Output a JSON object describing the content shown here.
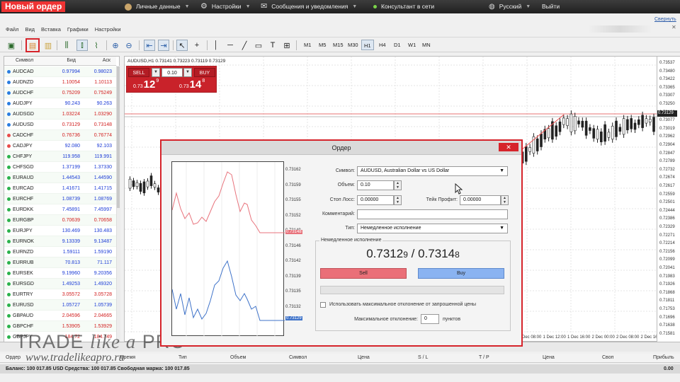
{
  "top": {
    "title": "Новый ордер",
    "personal": "Личные данные",
    "settings": "Настройки",
    "messages": "Сообщения и уведомления",
    "consultant": "Консультант в сети",
    "language": "Русский",
    "logout": "Выйти",
    "chart_link": "Свернуть"
  },
  "menu": [
    "Файл",
    "Вид",
    "Вставка",
    "Графики",
    "Настройки"
  ],
  "timeframes": [
    "M1",
    "M5",
    "M15",
    "M30",
    "H1",
    "H4",
    "D1",
    "W1",
    "MN"
  ],
  "active_timeframe": "H1",
  "market_watch": {
    "headers": {
      "symbol": "Символ",
      "bid": "Бид",
      "ask": "Аск"
    },
    "rows": [
      {
        "s": "AUDCAD",
        "b": "0.97994",
        "a": "0.98023",
        "dir": "up",
        "c": "#2a7de1"
      },
      {
        "s": "AUDNZD",
        "b": "1.10054",
        "a": "1.10113",
        "dir": "down",
        "c": "#2a7de1"
      },
      {
        "s": "AUDCHF",
        "b": "0.75209",
        "a": "0.75249",
        "dir": "down",
        "c": "#2a7de1"
      },
      {
        "s": "AUDJPY",
        "b": "90.243",
        "a": "90.263",
        "dir": "up",
        "c": "#2a7de1"
      },
      {
        "s": "AUDSGD",
        "b": "1.03224",
        "a": "1.03290",
        "dir": "down",
        "c": "#2a7de1"
      },
      {
        "s": "AUDUSD",
        "b": "0.73129",
        "a": "0.73148",
        "dir": "down",
        "c": "#2a7de1"
      },
      {
        "s": "CADCHF",
        "b": "0.76736",
        "a": "0.76774",
        "dir": "down",
        "c": "#e84c4c"
      },
      {
        "s": "CADJPY",
        "b": "92.080",
        "a": "92.103",
        "dir": "up",
        "c": "#e84c4c"
      },
      {
        "s": "CHFJPY",
        "b": "119.958",
        "a": "119.991",
        "dir": "up",
        "c": "#2bb24c"
      },
      {
        "s": "CHFSGD",
        "b": "1.37199",
        "a": "1.37330",
        "dir": "up",
        "c": "#2bb24c"
      },
      {
        "s": "EURAUD",
        "b": "1.44543",
        "a": "1.44590",
        "dir": "up",
        "c": "#2bb24c"
      },
      {
        "s": "EURCAD",
        "b": "1.41671",
        "a": "1.41715",
        "dir": "up",
        "c": "#2bb24c"
      },
      {
        "s": "EURCHF",
        "b": "1.08739",
        "a": "1.08769",
        "dir": "up",
        "c": "#2bb24c"
      },
      {
        "s": "EURDKK",
        "b": "7.45891",
        "a": "7.45997",
        "dir": "up",
        "c": "#2bb24c"
      },
      {
        "s": "EURGBP",
        "b": "0.70639",
        "a": "0.70658",
        "dir": "down",
        "c": "#2bb24c"
      },
      {
        "s": "EURJPY",
        "b": "130.469",
        "a": "130.483",
        "dir": "up",
        "c": "#2bb24c"
      },
      {
        "s": "EURNOK",
        "b": "9.13339",
        "a": "9.13487",
        "dir": "up",
        "c": "#2bb24c"
      },
      {
        "s": "EURNZD",
        "b": "1.59111",
        "a": "1.59190",
        "dir": "up",
        "c": "#2bb24c"
      },
      {
        "s": "EURRUB",
        "b": "70.813",
        "a": "71.117",
        "dir": "up",
        "c": "#2bb24c"
      },
      {
        "s": "EURSEK",
        "b": "9.19960",
        "a": "9.20356",
        "dir": "up",
        "c": "#2bb24c"
      },
      {
        "s": "EURSGD",
        "b": "1.49253",
        "a": "1.49320",
        "dir": "up",
        "c": "#2bb24c"
      },
      {
        "s": "EURTRY",
        "b": "3.05572",
        "a": "3.05728",
        "dir": "down",
        "c": "#2bb24c"
      },
      {
        "s": "EURUSD",
        "b": "1.05727",
        "a": "1.05739",
        "dir": "up",
        "c": "#2bb24c"
      },
      {
        "s": "GBPAUD",
        "b": "2.04596",
        "a": "2.04665",
        "dir": "down",
        "c": "#2bb24c"
      },
      {
        "s": "GBPCHF",
        "b": "1.53905",
        "a": "1.53929",
        "dir": "down",
        "c": "#2bb24c"
      },
      {
        "s": "GBPJPY",
        "b": "184.72",
        "a": "184.749",
        "dir": "down",
        "c": "#2bb24c"
      }
    ]
  },
  "chart": {
    "title": "AUDUSD,H1  0.73141 0.73223 0.73119 0.73129",
    "current": "0.73129",
    "price_labels": [
      "0.73537",
      "0.73480",
      "0.73422",
      "0.73365",
      "0.73307",
      "0.73250",
      "0.73192",
      "0.73077",
      "0.73019",
      "0.72962",
      "0.72904",
      "0.72847",
      "0.72789",
      "0.72732",
      "0.72674",
      "0.72617",
      "0.72559",
      "0.72501",
      "0.72444",
      "0.72386",
      "0.72329",
      "0.72271",
      "0.72214",
      "0.72156",
      "0.72099",
      "0.72041",
      "0.71983",
      "0.71926",
      "0.71868",
      "0.71811",
      "0.71753",
      "0.71696",
      "0.71638",
      "0.71581"
    ],
    "time_labels": [
      "1 Dec 08:00",
      "1 Dec 12:00",
      "1 Dec 16:00",
      "2 Dec 00:00",
      "2 Dec 08:00",
      "2 Dec 16:00"
    ]
  },
  "one_click": {
    "sell": "SELL",
    "buy": "BUY",
    "volume": "0.10",
    "sell_small": "0.73",
    "sell_big": "12",
    "sell_sup": "9",
    "buy_small": "0.73",
    "buy_big": "14",
    "buy_sup": "8"
  },
  "dialog": {
    "title": "Ордер",
    "symbol_label": "Символ:",
    "symbol_value": "AUDUSD, Australian Dollar vs US Dollar",
    "volume_label": "Объем:",
    "volume_value": "0.10",
    "sl_label": "Стоп Лосс:",
    "sl_value": "0.00000",
    "tp_label": "Тейк Профит:",
    "tp_value": "0.00000",
    "comment_label": "Комментарий:",
    "type_label": "Тип:",
    "type_value": "Немедленное исполнение",
    "section_label": "Немедленное исполнение",
    "bid_main": "0.7312",
    "bid_small": "9",
    "sep": " / ",
    "ask_main": "0.7314",
    "ask_small": "8",
    "sell": "Sell",
    "buy": "Buy",
    "deviation_check": "Использовать максимальное отклонение от запрошенной цены",
    "deviation_label": "Максимальное отклонение:",
    "deviation_value": "0",
    "deviation_unit": "пунктов",
    "mini_axis": [
      "0.73162",
      "0.73159",
      "0.73155",
      "0.73152",
      "0.73149",
      "0.73146",
      "0.73142",
      "0.73139",
      "0.73135",
      "0.73132"
    ],
    "mini_ask_tag": "0.73148",
    "mini_bid_tag": "0.73129"
  },
  "terminal": {
    "headers": [
      "Ордер",
      "Время",
      "Тип",
      "Объем",
      "Символ",
      "Цена",
      "S / L",
      "T / P",
      "Цена",
      "Своп",
      "Прибыль"
    ],
    "balance": "Баланс: 100 017.85 USD  Средства: 100 017.85  Свободная маржа: 100 017.85",
    "profit": "0.00"
  },
  "watermark": {
    "line1a": "TRADE ",
    "line1b": "like a",
    "line1c": " PRO",
    "line2": "www.tradelikeapro.ru"
  },
  "colors": {
    "accent": "#d6242b",
    "sell": "#ea6f78",
    "buy": "#8ab3f1",
    "up": "#1b3bd6",
    "down": "#d21e1e"
  }
}
